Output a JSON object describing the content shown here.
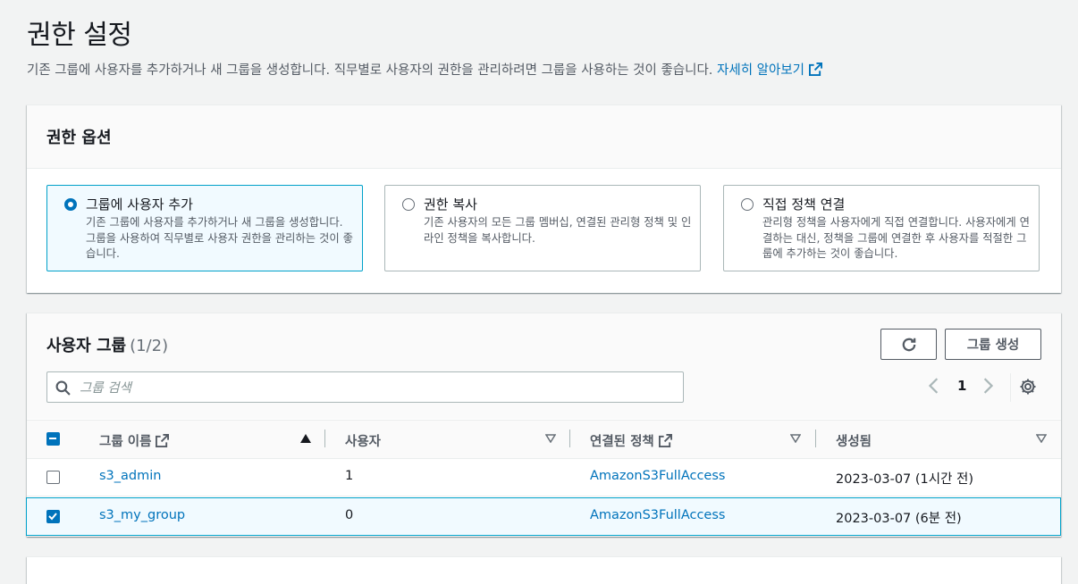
{
  "page": {
    "title": "권한 설정",
    "description": "기존 그룹에 사용자를 추가하거나 새 그룹을 생성합니다. 직무별로 사용자의 권한을 관리하려면 그룹을 사용하는 것이 좋습니다.",
    "learn_more": "자세히 알아보기"
  },
  "options": {
    "title": "권한 옵션",
    "tiles": [
      {
        "title": "그룹에 사용자 추가",
        "desc": "기존 그룹에 사용자를 추가하거나 새 그룹을 생성합니다. 그룹을 사용하여 직무별로 사용자 권한을 관리하는 것이 좋습니다.",
        "selected": true
      },
      {
        "title": "권한 복사",
        "desc": "기존 사용자의 모든 그룹 멤버십, 연결된 관리형 정책 및 인라인 정책을 복사합니다.",
        "selected": false
      },
      {
        "title": "직접 정책 연결",
        "desc": "관리형 정책을 사용자에게 직접 연결합니다. 사용자에게 연결하는 대신, 정책을 그룹에 연결한 후 사용자를 적절한 그룹에 추가하는 것이 좋습니다.",
        "selected": false
      }
    ]
  },
  "groups": {
    "title": "사용자 그룹",
    "count": "(1/2)",
    "create_button": "그룹 생성",
    "search_placeholder": "그룹 검색",
    "page_number": "1",
    "columns": {
      "name": "그룹 이름",
      "users": "사용자",
      "policies": "연결된 정책",
      "created": "생성됨"
    },
    "rows": [
      {
        "name": "s3_admin",
        "users": "1",
        "policy": "AmazonS3FullAccess",
        "created": "2023-03-07 (1시간 전)",
        "checked": false
      },
      {
        "name": "s3_my_group",
        "users": "0",
        "policy": "AmazonS3FullAccess",
        "created": "2023-03-07 (6분 전)",
        "checked": true
      }
    ]
  },
  "colors": {
    "link": "#0073bb",
    "selected_bg": "#f1faff",
    "selected_border": "#00a1c9"
  }
}
